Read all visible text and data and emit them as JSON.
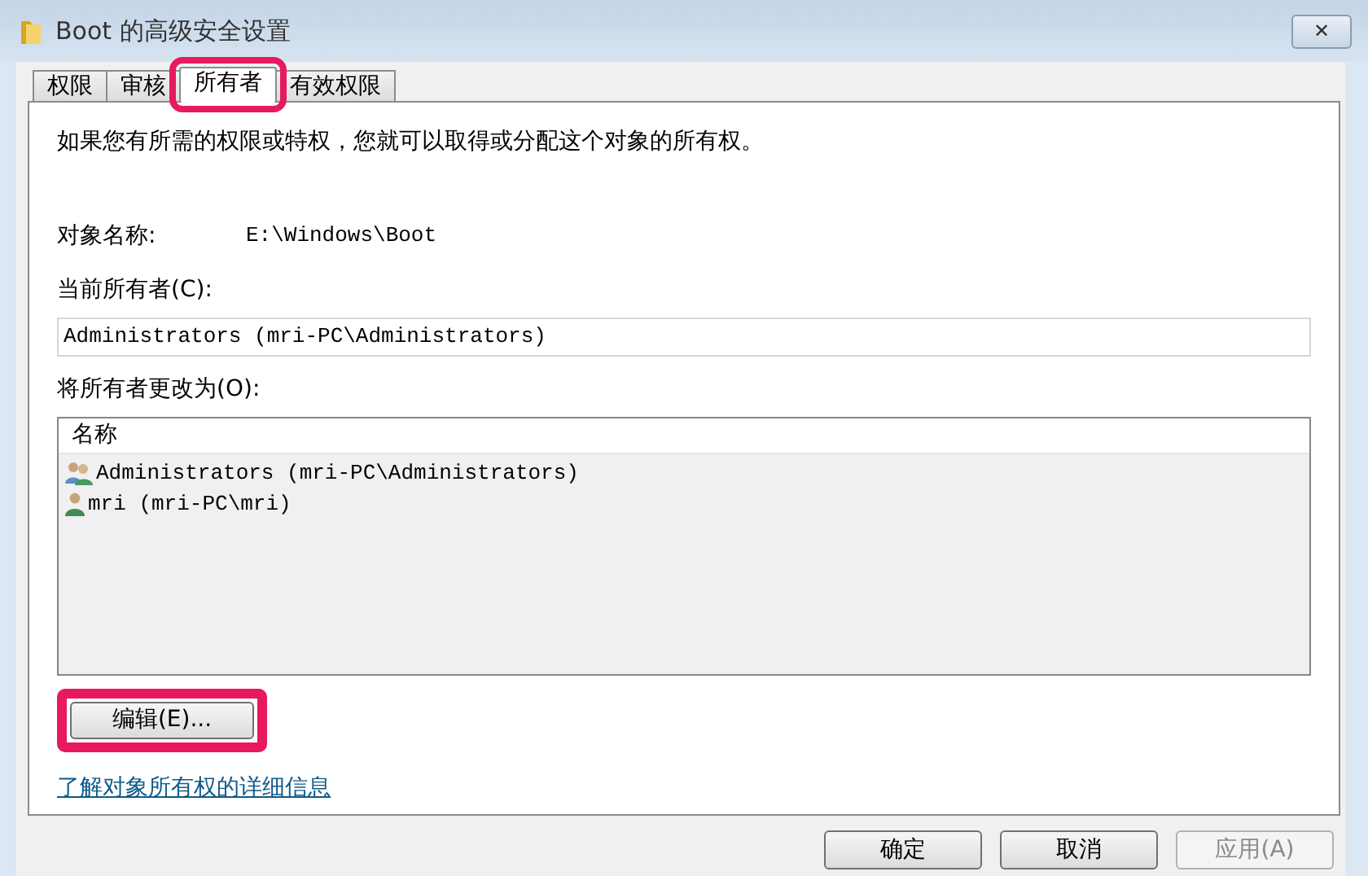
{
  "window": {
    "title": "Boot 的高级安全设置",
    "close": "✕"
  },
  "tabs": [
    {
      "label": "权限",
      "selected": false,
      "highlighted": false
    },
    {
      "label": "审核",
      "selected": false,
      "highlighted": false
    },
    {
      "label": "所有者",
      "selected": true,
      "highlighted": true
    },
    {
      "label": "有效权限",
      "selected": false,
      "highlighted": false
    }
  ],
  "intro": "如果您有所需的权限或特权，您就可以取得或分配这个对象的所有权。",
  "object_name": {
    "label": "对象名称:",
    "value": "E:\\Windows\\Boot"
  },
  "current_owner": {
    "label": "当前所有者(C):",
    "value": "Administrators (mri-PC\\Administrators)"
  },
  "change_owner": {
    "label": "将所有者更改为(O):",
    "column": "名称",
    "items": [
      {
        "name": "Administrators (mri-PC\\Administrators)",
        "kind": "group"
      },
      {
        "name": "mri (mri-PC\\mri)",
        "kind": "user"
      }
    ]
  },
  "edit_button": {
    "label": "编辑(E)...",
    "highlighted": true
  },
  "link": "了解对象所有权的详细信息",
  "buttons": [
    {
      "label": "确定",
      "disabled": false
    },
    {
      "label": "取消",
      "disabled": false
    },
    {
      "label": "应用(A)",
      "disabled": true
    }
  ]
}
